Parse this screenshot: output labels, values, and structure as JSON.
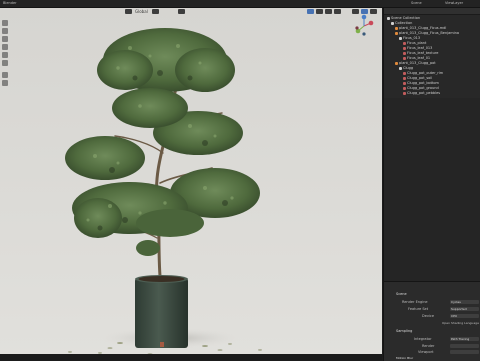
{
  "header": {
    "title": "Blender",
    "menu_label": "Scene",
    "view_layer_label": "ViewLayer",
    "view_mode_label": "Global"
  },
  "outliner": {
    "title": "Scene Collection",
    "rows": [
      {
        "label": "Scene Collection",
        "indent": 0,
        "icon_color": "#d0d0d0"
      },
      {
        "label": "Collection",
        "indent": 1,
        "icon_color": "#d0d0d0"
      },
      {
        "label": "plant_013_Clugg_Ficus.mdl",
        "indent": 2,
        "icon_color": "#e08a3c"
      },
      {
        "label": "plant_013_Clugg_Ficus_Benjamina",
        "indent": 2,
        "icon_color": "#e08a3c"
      },
      {
        "label": "Ficus_013",
        "indent": 3,
        "icon_color": "#d0d0d0"
      },
      {
        "label": "Ficus_plant",
        "indent": 4,
        "icon_color": "#c25c5c"
      },
      {
        "label": "Ficus_leaf_013",
        "indent": 4,
        "icon_color": "#c25c5c"
      },
      {
        "label": "Ficus_leaf_texture",
        "indent": 4,
        "icon_color": "#c25c5c"
      },
      {
        "label": "Ficus_leaf_01",
        "indent": 4,
        "icon_color": "#c25c5c"
      },
      {
        "label": "plant_013_Clugg_pot",
        "indent": 2,
        "icon_color": "#e08a3c"
      },
      {
        "label": "Clugg",
        "indent": 3,
        "icon_color": "#d0d0d0"
      },
      {
        "label": "Clugg_pot_outer_rim",
        "indent": 4,
        "icon_color": "#c25c5c"
      },
      {
        "label": "Clugg_pot_soil",
        "indent": 4,
        "icon_color": "#c25c5c"
      },
      {
        "label": "Clugg_pot_bottom",
        "indent": 4,
        "icon_color": "#c25c5c"
      },
      {
        "label": "Clugg_pot_ground",
        "indent": 4,
        "icon_color": "#c25c5c"
      },
      {
        "label": "Clugg_pot_pebbles",
        "indent": 4,
        "icon_color": "#c25c5c"
      }
    ]
  },
  "properties": {
    "scene_label": "Scene",
    "render_engine_label": "Render Engine",
    "render_engine_value": "Cycles",
    "feature_set_label": "Feature Set",
    "feature_set_value": "Supported",
    "device_label": "Device",
    "device_value": "CPU",
    "open_shading_label": "Open Shading Language",
    "sampling_label": "Sampling",
    "integrator_label": "Integrator",
    "integrator_value": "Path Tracing",
    "render_label": "Render",
    "viewport_label": "Viewport",
    "motion_blur_label": "Motion Blur",
    "denoising_label": "Denoising"
  },
  "colors": {
    "accent": "#4772b3",
    "ui_bg": "#1d1d1d",
    "viewport_bg": "#dcdbd7",
    "pot": "#3b4a40",
    "foliage": "#4f6a3d"
  }
}
